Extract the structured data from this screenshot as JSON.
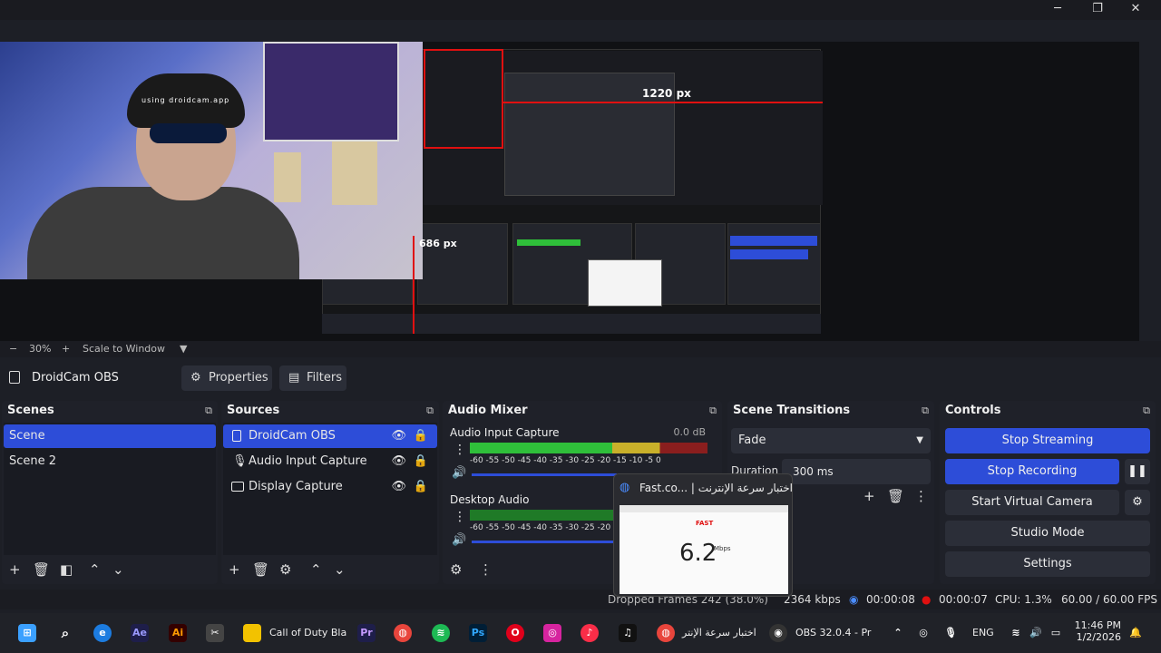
{
  "window": {
    "minimize": "─",
    "maximize": "❐",
    "close": "✕"
  },
  "preview": {
    "webcam_watermark": "using droidcam.app",
    "label_width": "1220 px",
    "label_height": "686 px",
    "zoom_minus": "−",
    "zoom": "30%",
    "zoom_plus": "+",
    "scale_mode": "Scale to Window"
  },
  "source_toolbar": {
    "source_name": "DroidCam OBS",
    "properties": "Properties",
    "filters": "Filters"
  },
  "scenes": {
    "title": "Scenes",
    "items": [
      "Scene",
      "Scene 2"
    ]
  },
  "sources": {
    "title": "Sources",
    "items": [
      "DroidCam OBS",
      "Audio Input Capture",
      "Display Capture"
    ]
  },
  "audio_mixer": {
    "title": "Audio Mixer",
    "channels": [
      {
        "name": "Audio Input Capture",
        "level": "0.0 dB"
      },
      {
        "name": "Desktop Audio",
        "level": ""
      }
    ],
    "scale": "-60 -55 -50 -45 -40 -35 -30 -25 -20 -15 -10 -5 0"
  },
  "transitions": {
    "title": "Scene Transitions",
    "selected": "Fade",
    "duration_label": "Duration",
    "duration": "300 ms"
  },
  "controls": {
    "title": "Controls",
    "stop_streaming": "Stop Streaming",
    "stop_recording": "Stop Recording",
    "start_virtual_camera": "Start Virtual Camera",
    "studio_mode": "Studio Mode",
    "settings": "Settings"
  },
  "status": {
    "dropped": "Dropped Frames 242 (38.0%)",
    "bitrate": "2364 kbps",
    "stream_time": "00:00:08",
    "rec_time": "00:00:07",
    "cpu": "CPU: 1.3%",
    "fps": "60.00 / 60.00 FPS"
  },
  "popup": {
    "title": "Fast.co... | اختبار سرعة الإنترنت",
    "speed": "6.2",
    "unit": "Mbps",
    "brand": "FAST"
  },
  "taskbar": {
    "items": [
      {
        "label": "Call of Duty Bla"
      },
      {
        "label": "اختبار سرعة الإنتر"
      },
      {
        "label": "OBS 32.0.4 - Pr"
      }
    ],
    "lang": "ENG",
    "time": "11:46 PM",
    "date": "1/2/2026"
  },
  "colors": {
    "accent": "#2d4dd8",
    "record": "#e01010"
  }
}
